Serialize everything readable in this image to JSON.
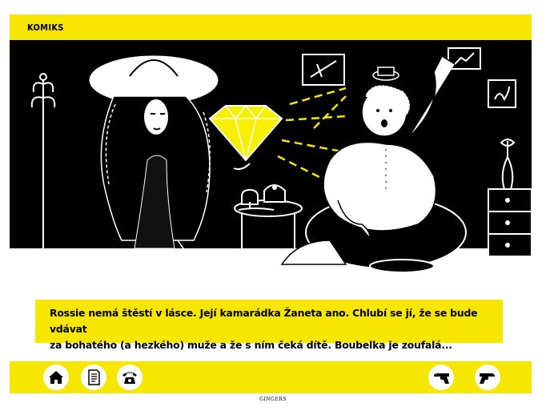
{
  "header": {
    "title": "KOMIKS"
  },
  "caption": {
    "line1": "Rossie nemá štěstí v lásce. Její kamarádka Žaneta ano. Chlubí se jí, že se bude vdávat",
    "line2": "za bohatého (a hezkého) muže a že s ním čeká dítě. Boubelka je zoufalá..."
  },
  "footer": {
    "brand": "GINGERS",
    "left_buttons": [
      "home-icon",
      "document-icon",
      "telephone-icon"
    ],
    "right_buttons": [
      "revolver-left-icon",
      "revolver-right-icon"
    ]
  },
  "colors": {
    "accent_yellow": "#f7e600",
    "stage_black": "#000000",
    "line_white": "#ffffff"
  }
}
